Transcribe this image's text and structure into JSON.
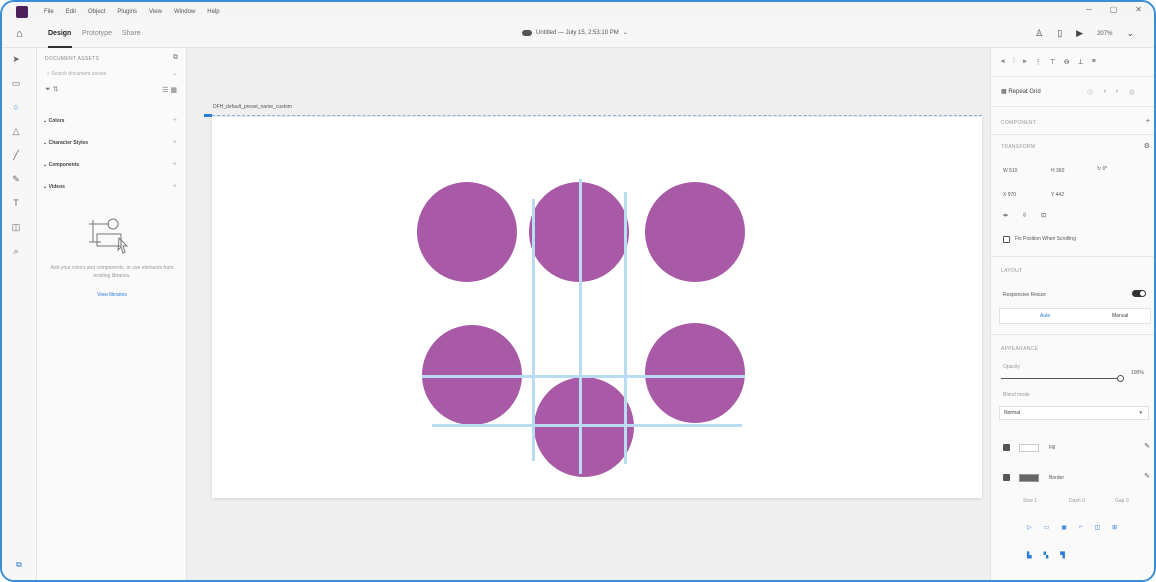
{
  "menubar": {
    "items": [
      "File",
      "Edit",
      "Object",
      "Plugins",
      "View",
      "Window",
      "Help"
    ],
    "window_controls": [
      "─",
      "▢",
      "✕"
    ]
  },
  "topbar": {
    "tabs": [
      "Design",
      "Prototype",
      "Share"
    ],
    "doc_title": "Untitled — July 15, 2:53:10 PM",
    "zoom": "207%"
  },
  "left_panel": {
    "header": "DOCUMENT ASSETS",
    "search_placeholder": "Search document assets",
    "sections": [
      "Colors",
      "Character Styles",
      "Components",
      "Videos"
    ],
    "empty_text": "Add your colors and components, or use elements from existing libraries.",
    "link": "View libraries"
  },
  "canvas": {
    "artboard_label": "DFH_default_preset_name_custom"
  },
  "right_panel": {
    "repeat_grid": "Repeat Grid",
    "component_label": "COMPONENT",
    "transform_label": "TRANSFORM",
    "w_label": "W",
    "w_value": "510",
    "h_label": "H",
    "h_value": "360",
    "x_label": "X",
    "x_value": "970",
    "y_label": "Y",
    "y_value": "442",
    "rotation": "0°",
    "fix_position": "Fix Position When Scrolling",
    "layout_label": "LAYOUT",
    "responsive_resize": "Responsive Resize",
    "auto": "Auto",
    "manual": "Manual",
    "appearance_label": "APPEARANCE",
    "opacity_label": "Opacity",
    "opacity_value": "100%",
    "blend_label": "Blend mode",
    "blend_value": "Normal",
    "fill_label": "Fill",
    "border_label": "Border",
    "size_label": "Size",
    "size_value": "1",
    "dash_label": "Dash",
    "dash_value": "0",
    "gap_label": "Gap",
    "gap_value": "0"
  },
  "colors": {
    "circle": "#a85aa6",
    "guide": "#b9dcf2",
    "accent": "#2a7dd6"
  }
}
